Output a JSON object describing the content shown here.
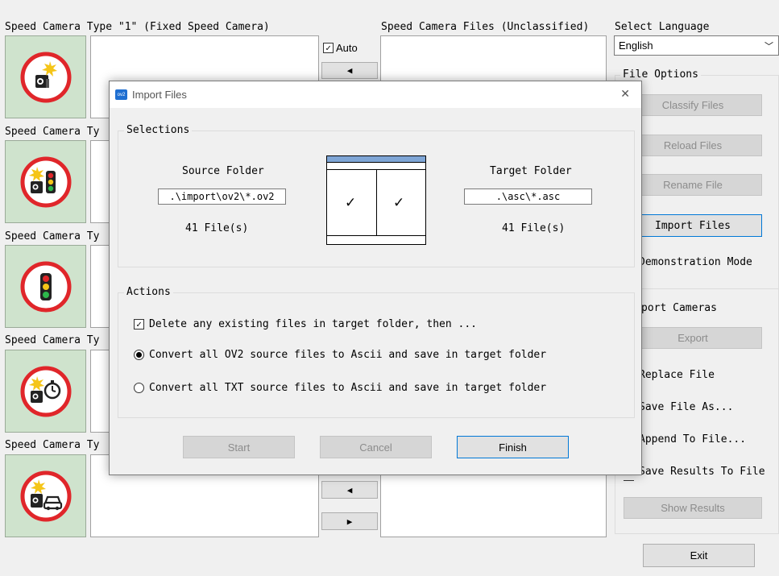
{
  "left_panel": {
    "header_full": "Speed Camera Type \"1\" (Fixed Speed Camera)",
    "headers_truncated": [
      "Speed Camera Ty",
      "Speed Camera Ty",
      "Speed Camera Ty",
      "Speed Camera Ty"
    ],
    "icons": [
      "fixed-speed-camera-icon",
      "red-light-camera-icon",
      "traffic-light-icon",
      "average-speed-camera-icon",
      "mobile-speed-camera-icon"
    ]
  },
  "auto_label": "Auto",
  "auto_checked": true,
  "arrow_left": "◀",
  "arrow_right": "▶",
  "unclassified_header": "Speed Camera Files (Unclassified)",
  "right_panel": {
    "select_language_label": "Select Language",
    "language_value": "English",
    "file_options_label": "File Options",
    "classify_files": "Classify Files",
    "reload_files": "Reload Files",
    "rename_file": "Rename File",
    "import_files": "Import Files",
    "demonstration_mode": "Demonstration Mode",
    "export_cameras_label": "port Cameras",
    "export": "Export",
    "replace_file": "Replace File",
    "save_file_as": "Save File As...",
    "append_to_file": "Append To File...",
    "save_results_to_file": "Save Results To File",
    "show_results": "Show Results",
    "exit": "Exit"
  },
  "dialog": {
    "title": "Import Files",
    "close_glyph": "✕",
    "selections_label": "Selections",
    "source_folder_label": "Source Folder",
    "source_path": ".\\import\\ov2\\*.ov2",
    "source_count": "41 File(s)",
    "target_folder_label": "Target Folder",
    "target_path": ".\\asc\\*.asc",
    "target_count": "41 File(s)",
    "actions_label": "Actions",
    "delete_existing": "Delete any existing files in target folder, then ...",
    "delete_checked": true,
    "convert_ov2": "Convert all OV2 source files to Ascii and save in target folder",
    "convert_txt": "Convert all TXT source files to Ascii and save in target folder",
    "selected_option": "ov2",
    "start": "Start",
    "cancel": "Cancel",
    "finish": "Finish"
  },
  "colors": {
    "accent": "#0078d7",
    "icon_bg": "#cfe3cd",
    "sign_red": "#e0262a"
  }
}
